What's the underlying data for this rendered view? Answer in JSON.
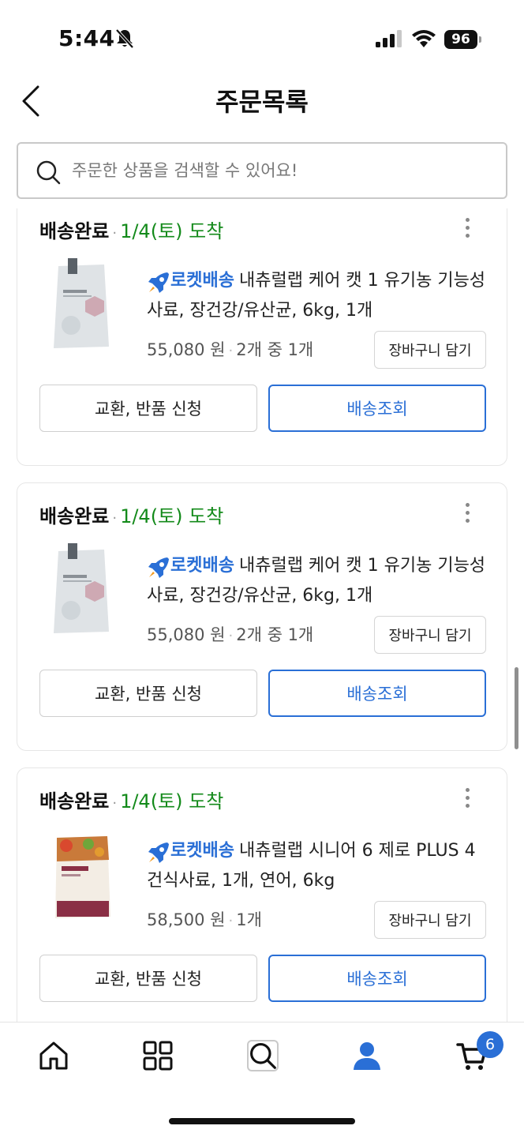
{
  "status_bar": {
    "time": "5:44",
    "battery": "96"
  },
  "header": {
    "title": "주문목록"
  },
  "search": {
    "placeholder": "주문한 상품을 검색할 수 있어요!"
  },
  "orders": [
    {
      "status": "배송완료",
      "arrival": "1/4(토) 도착",
      "rocket_label": "로켓배송",
      "title": "내츄럴랩 케어 캣 1 유기농 기능성 사료, 장건강/유산균, 6kg, 1개",
      "price": "55,080 원",
      "quantity": "2개 중 1개",
      "cart_button": "장바구니 담기",
      "exchange_button": "교환, 반품 신청",
      "track_button": "배송조회"
    },
    {
      "status": "배송완료",
      "arrival": "1/4(토) 도착",
      "rocket_label": "로켓배송",
      "title": "내츄럴랩 케어 캣 1 유기농 기능성 사료, 장건강/유산균, 6kg, 1개",
      "price": "55,080 원",
      "quantity": "2개 중 1개",
      "cart_button": "장바구니 담기",
      "exchange_button": "교환, 반품 신청",
      "track_button": "배송조회"
    },
    {
      "status": "배송완료",
      "arrival": "1/4(토) 도착",
      "rocket_label": "로켓배송",
      "title": "내츄럴랩 시니어 6 제로 PLUS 4 건식사료, 1개, 연어, 6kg",
      "price": "58,500 원",
      "quantity": "1개",
      "cart_button": "장바구니 담기",
      "exchange_button": "교환, 반품 신청",
      "track_button": "배송조회"
    }
  ],
  "tabbar": {
    "cart_badge": "6"
  },
  "colors": {
    "accent": "#2a6fd6",
    "arrival_green": "#138a1a"
  }
}
